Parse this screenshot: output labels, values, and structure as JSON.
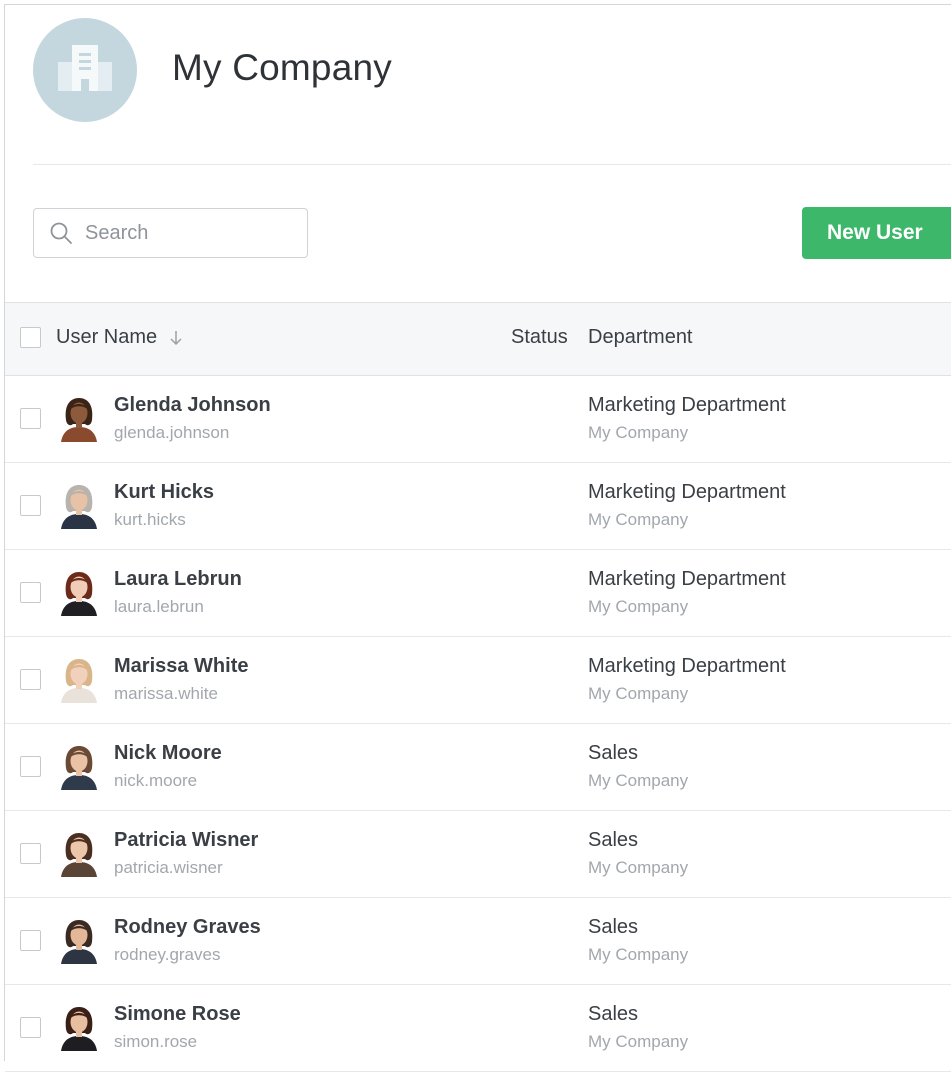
{
  "header": {
    "title": "My Company",
    "logo_icon": "building-icon"
  },
  "toolbar": {
    "search_placeholder": "Search",
    "search_value": "",
    "new_user_label": "New User",
    "accent_color": "#3db86b"
  },
  "table": {
    "columns": {
      "user_name": "User Name",
      "status": "Status",
      "department": "Department"
    },
    "sort_icon": "arrow-down-icon",
    "rows": [
      {
        "name": "Glenda Johnson",
        "login": "glenda.johnson",
        "department": "Marketing Department",
        "company": "My Company",
        "avatar": "woman-curly-hair",
        "skin": "#8d5a3b",
        "hair": "#3a2418",
        "cloth": "#8a4a2e"
      },
      {
        "name": "Kurt Hicks",
        "login": "kurt.hicks",
        "department": "Marketing Department",
        "company": "My Company",
        "avatar": "man-suit-glasses",
        "skin": "#e8c2a6",
        "hair": "#b9b3ad",
        "cloth": "#2b3445"
      },
      {
        "name": "Laura Lebrun",
        "login": "laura.lebrun",
        "department": "Marketing Department",
        "company": "My Company",
        "avatar": "woman-dark-hair",
        "skin": "#f0cdb6",
        "hair": "#6b2a1a",
        "cloth": "#1f1f24"
      },
      {
        "name": "Marissa White",
        "login": "marissa.white",
        "department": "Marketing Department",
        "company": "My Company",
        "avatar": "woman-blonde",
        "skin": "#f1d1bb",
        "hair": "#d9b58a",
        "cloth": "#e9e2da"
      },
      {
        "name": "Nick Moore",
        "login": "nick.moore",
        "department": "Sales",
        "company": "My Company",
        "avatar": "man-shirt",
        "skin": "#eac3a7",
        "hair": "#6a4a35",
        "cloth": "#2f3a4a"
      },
      {
        "name": "Patricia Wisner",
        "login": "patricia.wisner",
        "department": "Sales",
        "company": "My Company",
        "avatar": "woman-bun",
        "skin": "#ecc6aa",
        "hair": "#4a2e20",
        "cloth": "#5a4436"
      },
      {
        "name": "Rodney Graves",
        "login": "rodney.graves",
        "department": "Sales",
        "company": "My Company",
        "avatar": "man-beard-suit",
        "skin": "#e2b898",
        "hair": "#3b2a22",
        "cloth": "#2d3442"
      },
      {
        "name": "Simone Rose",
        "login": "simon.rose",
        "department": "Sales",
        "company": "My Company",
        "avatar": "woman-long-hair",
        "skin": "#e8bea0",
        "hair": "#3a1f16",
        "cloth": "#1e1e22"
      }
    ]
  }
}
